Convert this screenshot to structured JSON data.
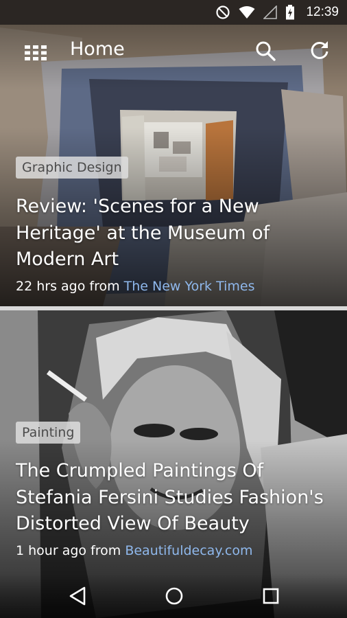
{
  "status_bar": {
    "time": "12:39",
    "icons": [
      "do-not-disturb-icon",
      "wifi-icon",
      "signal-icon",
      "battery-charging-icon"
    ]
  },
  "app_bar": {
    "title": "Home",
    "icons": [
      "apps-grid-icon",
      "search-icon",
      "refresh-icon"
    ]
  },
  "articles": [
    {
      "category": "Graphic Design",
      "title": "Review: 'Scenes for a New Heritage' at the Museum of Modern Art",
      "time_ago": "22 hrs ago",
      "from_label": "from",
      "source": "The New York Times"
    },
    {
      "category": "Painting",
      "title": "The Crumpled Paintings Of Stefania Fersini Studies Fashion's Distorted View Of Beauty",
      "time_ago": "1 hour ago",
      "from_label": "from",
      "source": "Beautifuldecay.com"
    }
  ],
  "nav_bar": {
    "icons": [
      "back-icon",
      "home-icon",
      "recents-icon"
    ]
  },
  "colors": {
    "status_bar": "#2b2623",
    "source_link": "#8fb8ec",
    "chip_bg": "#e1e1e1",
    "chip_text": "#4b4b4b"
  }
}
